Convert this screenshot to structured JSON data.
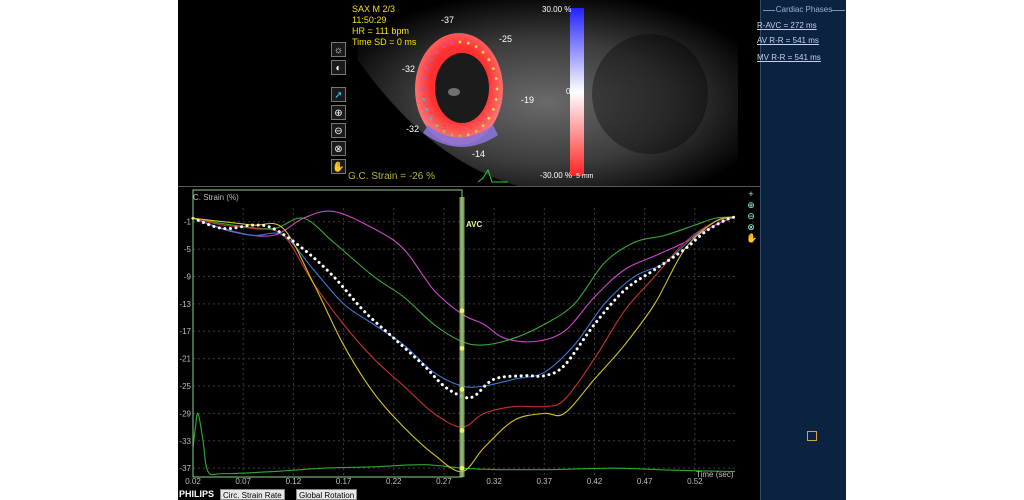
{
  "echo": {
    "view": "SAX M  2/3",
    "time": "11:50:29",
    "hr": "HR = 111 bpm",
    "time_sd": "Time SD = 0 ms",
    "segment_values": [
      "-37",
      "-25",
      "-32",
      "-19",
      "-32",
      "-14"
    ],
    "scale_top": "30.00 %",
    "scale_mid": "0",
    "scale_bottom": "-30.00 %",
    "scale_unit": "5 mm",
    "strain_readout": "G.C. Strain = -26 %"
  },
  "toolbar": {
    "icons": [
      "brightness-icon",
      "contrast-icon",
      "pointer-icon",
      "zoom-in-icon",
      "zoom-out-icon",
      "zoom-reset-icon",
      "pan-hand-icon",
      "settings-icon"
    ]
  },
  "graph": {
    "ylabel": "C. Strain (%)",
    "xlabel": "Time (sec)",
    "marker_label": "AVC",
    "grid": true
  },
  "chart_data": {
    "type": "line",
    "title": "",
    "xlabel": "Time (sec)",
    "ylabel": "C. Strain (%)",
    "xlim": [
      0.02,
      0.56
    ],
    "ylim": [
      -38,
      1
    ],
    "x_ticks": [
      "0.02",
      "0.07",
      "0.12",
      "0.17",
      "0.22",
      "0.27",
      "0.32",
      "0.37",
      "0.42",
      "0.47",
      "0.52"
    ],
    "y_ticks": [
      "-1",
      "-5",
      "-9",
      "-13",
      "-17",
      "-21",
      "-25",
      "-29",
      "-33",
      "-37"
    ],
    "avc_time": 0.288,
    "series": [
      {
        "color": "#ffffff",
        "style": "dotted",
        "x": [
          0.02,
          0.05,
          0.08,
          0.1,
          0.13,
          0.16,
          0.19,
          0.22,
          0.25,
          0.27,
          0.288,
          0.3,
          0.32,
          0.35,
          0.37,
          0.39,
          0.42,
          0.45,
          0.48,
          0.51,
          0.53,
          0.55,
          0.56
        ],
        "y": [
          -0.5,
          -2,
          -1.5,
          -2,
          -5,
          -9,
          -14,
          -18,
          -22,
          -25,
          -26.5,
          -26.5,
          -24,
          -23.5,
          -23.5,
          -22,
          -16,
          -11,
          -8,
          -5,
          -2.5,
          -0.8,
          -0.3
        ]
      },
      {
        "color": "#d044d0",
        "x": [
          0.02,
          0.06,
          0.1,
          0.13,
          0.16,
          0.2,
          0.23,
          0.26,
          0.288,
          0.31,
          0.33,
          0.36,
          0.39,
          0.42,
          0.45,
          0.48,
          0.51,
          0.54,
          0.56
        ],
        "y": [
          -0.5,
          -2.5,
          -3,
          -0.5,
          0.5,
          -2,
          -5,
          -11,
          -14.5,
          -16,
          -18,
          -18.5,
          -17,
          -12,
          -8,
          -6,
          -4,
          -1.5,
          -0.3
        ]
      },
      {
        "color": "#3aa83a",
        "x": [
          0.02,
          0.06,
          0.1,
          0.13,
          0.16,
          0.2,
          0.23,
          0.26,
          0.288,
          0.31,
          0.34,
          0.37,
          0.4,
          0.43,
          0.46,
          0.49,
          0.52,
          0.54,
          0.56
        ],
        "y": [
          -0.5,
          -1.5,
          -2,
          -0.5,
          -4,
          -9,
          -12,
          -16,
          -18.5,
          -19,
          -18,
          -16,
          -13,
          -7,
          -4,
          -3,
          -1.5,
          -0.5,
          -0.3
        ]
      },
      {
        "color": "#3a7ad0",
        "x": [
          0.02,
          0.05,
          0.08,
          0.11,
          0.14,
          0.17,
          0.2,
          0.23,
          0.26,
          0.288,
          0.31,
          0.34,
          0.37,
          0.4,
          0.43,
          0.46,
          0.49,
          0.52,
          0.54,
          0.56
        ],
        "y": [
          -0.5,
          -2,
          -3,
          -3,
          -8,
          -13,
          -16,
          -19,
          -23,
          -25,
          -25,
          -24,
          -23,
          -19,
          -13,
          -9,
          -7,
          -3,
          -1,
          -0.3
        ]
      },
      {
        "color": "#c83232",
        "x": [
          0.02,
          0.05,
          0.08,
          0.11,
          0.14,
          0.17,
          0.2,
          0.23,
          0.26,
          0.288,
          0.31,
          0.34,
          0.37,
          0.39,
          0.42,
          0.45,
          0.48,
          0.51,
          0.54,
          0.56
        ],
        "y": [
          -0.5,
          -1.5,
          -2,
          -3,
          -10,
          -16,
          -21,
          -25,
          -29,
          -31,
          -29,
          -28,
          -28,
          -27,
          -21,
          -14,
          -9,
          -4,
          -1,
          -0.3
        ]
      },
      {
        "color": "#d4c42a",
        "x": [
          0.02,
          0.05,
          0.08,
          0.11,
          0.14,
          0.17,
          0.2,
          0.23,
          0.26,
          0.288,
          0.31,
          0.34,
          0.37,
          0.39,
          0.42,
          0.45,
          0.48,
          0.51,
          0.54,
          0.56
        ],
        "y": [
          -0.5,
          -1,
          -1.5,
          -2,
          -10,
          -19,
          -26,
          -31,
          -35,
          -37.5,
          -34,
          -30,
          -29,
          -29,
          -24,
          -19,
          -13,
          -5,
          -1,
          -0.3
        ]
      },
      {
        "color": "#2faa2f",
        "x": [
          0.02,
          0.022,
          0.025,
          0.03,
          0.035,
          0.05,
          0.1,
          0.15,
          0.2,
          0.25,
          0.288,
          0.32,
          0.38,
          0.44,
          0.5,
          0.56
        ],
        "y": [
          -34,
          -31.5,
          -29,
          -33,
          -37.5,
          -37.8,
          -37.5,
          -37,
          -36.8,
          -36.5,
          -37,
          -37.2,
          -37.2,
          -37,
          -37.3,
          -37.5
        ]
      }
    ]
  },
  "right_panel": {
    "title": "Cardiac Phases",
    "items": [
      "R-AVC = 272 ms",
      "AV R-R = 541 ms",
      "MV R-R = 541 ms"
    ]
  },
  "bottom": {
    "brand": "PHILIPS",
    "tabs": [
      "Circ. Strain Rate",
      "Global Rotation"
    ]
  }
}
